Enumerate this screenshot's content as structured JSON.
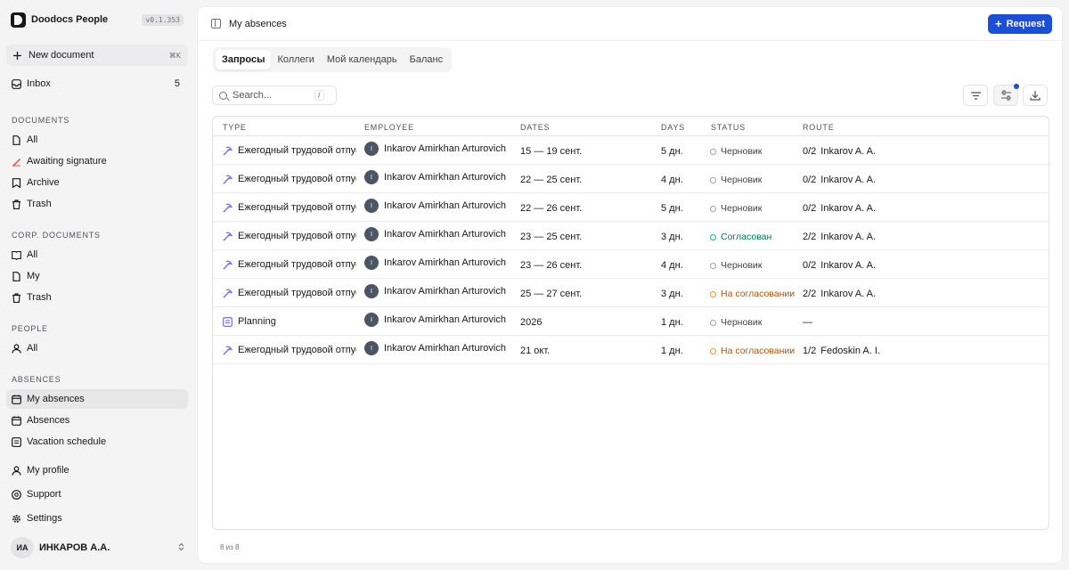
{
  "app": {
    "name": "Doodocs People",
    "version": "v0.1.353"
  },
  "sidebar": {
    "new_document": "New document",
    "new_document_shortcut": "⌘K",
    "inbox": {
      "label": "Inbox",
      "count": "5"
    },
    "sections": {
      "documents": "DOCUMENTS",
      "corp_documents": "CORP. DOCUMENTS",
      "people": "PEOPLE",
      "absences": "ABSENCES"
    },
    "documents": {
      "all": "All",
      "awaiting_signature": "Awaiting signature",
      "archive": "Archive",
      "trash": "Trash"
    },
    "corp_documents": {
      "all": "All",
      "my": "My",
      "trash": "Trash"
    },
    "people": {
      "all": "All"
    },
    "absences": {
      "my_absences": "My absences",
      "absences": "Absences",
      "vacation_schedule": "Vacation schedule"
    },
    "bottom": {
      "my_profile": "My profile",
      "support": "Support",
      "settings": "Settings"
    },
    "user": {
      "initials": "ИА",
      "name": "ИНКАРОВ А.А."
    }
  },
  "header": {
    "title": "My absences",
    "request_button": "Request"
  },
  "tabs": [
    "Запросы",
    "Коллеги",
    "Мой календарь",
    "Баланс"
  ],
  "search": {
    "placeholder": "Search...",
    "shortcut": "/"
  },
  "table": {
    "columns": {
      "type": "TYPE",
      "employee": "EMPLOYEE",
      "dates": "DATES",
      "days": "DAYS",
      "status": "STATUS",
      "route": "ROUTE"
    },
    "rows": [
      {
        "type": "Ежегодный трудовой отпуск",
        "employee": "Inkarov Amirkhan Arturovich",
        "avatar": "I",
        "dates": "15 — 19 сент.",
        "days": "5 дн.",
        "status": "Черновик",
        "status_color": "#a1a1aa",
        "status_text_color": "#3f3f46",
        "route_frac": "0/2",
        "route_name": "Inkarov A. A."
      },
      {
        "type": "Ежегодный трудовой отпуск",
        "employee": "Inkarov Amirkhan Arturovich",
        "avatar": "I",
        "dates": "22 — 25 сент.",
        "days": "4 дн.",
        "status": "Черновик",
        "status_color": "#a1a1aa",
        "status_text_color": "#3f3f46",
        "route_frac": "0/2",
        "route_name": "Inkarov A. A."
      },
      {
        "type": "Ежегодный трудовой отпуск",
        "employee": "Inkarov Amirkhan Arturovich",
        "avatar": "I",
        "dates": "22 — 26 сент.",
        "days": "5 дн.",
        "status": "Черновик",
        "status_color": "#a1a1aa",
        "status_text_color": "#3f3f46",
        "route_frac": "0/2",
        "route_name": "Inkarov A. A."
      },
      {
        "type": "Ежегодный трудовой отпуск",
        "employee": "Inkarov Amirkhan Arturovich",
        "avatar": "I",
        "dates": "23 — 25 сент.",
        "days": "3 дн.",
        "status": "Согласован",
        "status_color": "#10b981",
        "status_text_color": "#047857",
        "route_frac": "2/2",
        "route_name": "Inkarov A. A."
      },
      {
        "type": "Ежегодный трудовой отпуск",
        "employee": "Inkarov Amirkhan Arturovich",
        "avatar": "I",
        "dates": "23 — 26 сент.",
        "days": "4 дн.",
        "status": "Черновик",
        "status_color": "#a1a1aa",
        "status_text_color": "#3f3f46",
        "route_frac": "0/2",
        "route_name": "Inkarov A. A."
      },
      {
        "type": "Ежегодный трудовой отпуск",
        "employee": "Inkarov Amirkhan Arturovich",
        "avatar": "I",
        "dates": "25 — 27 сент.",
        "days": "3 дн.",
        "status": "На согласовании",
        "status_color": "#f59e0b",
        "status_text_color": "#b45309",
        "route_frac": "2/2",
        "route_name": "Inkarov A. A."
      },
      {
        "type": "Planning",
        "employee": "Inkarov Amirkhan Arturovich",
        "avatar": "I",
        "dates": "2026",
        "days": "1 дн.",
        "status": "Черновик",
        "status_color": "#a1a1aa",
        "status_text_color": "#3f3f46",
        "route_frac": "—",
        "route_name": ""
      },
      {
        "type": "Ежегодный трудовой отпуск",
        "employee": "Inkarov Amirkhan Arturovich",
        "avatar": "I",
        "dates": "21 окт.",
        "days": "1 дн.",
        "status": "На согласовании",
        "status_color": "#f59e0b",
        "status_text_color": "#b45309",
        "route_frac": "1/2",
        "route_name": "Fedoskin A. I."
      }
    ]
  },
  "footer": {
    "count": "8 из 8"
  },
  "colors": {
    "accent": "#1d4ed8",
    "type_icon": "#6366f1"
  }
}
